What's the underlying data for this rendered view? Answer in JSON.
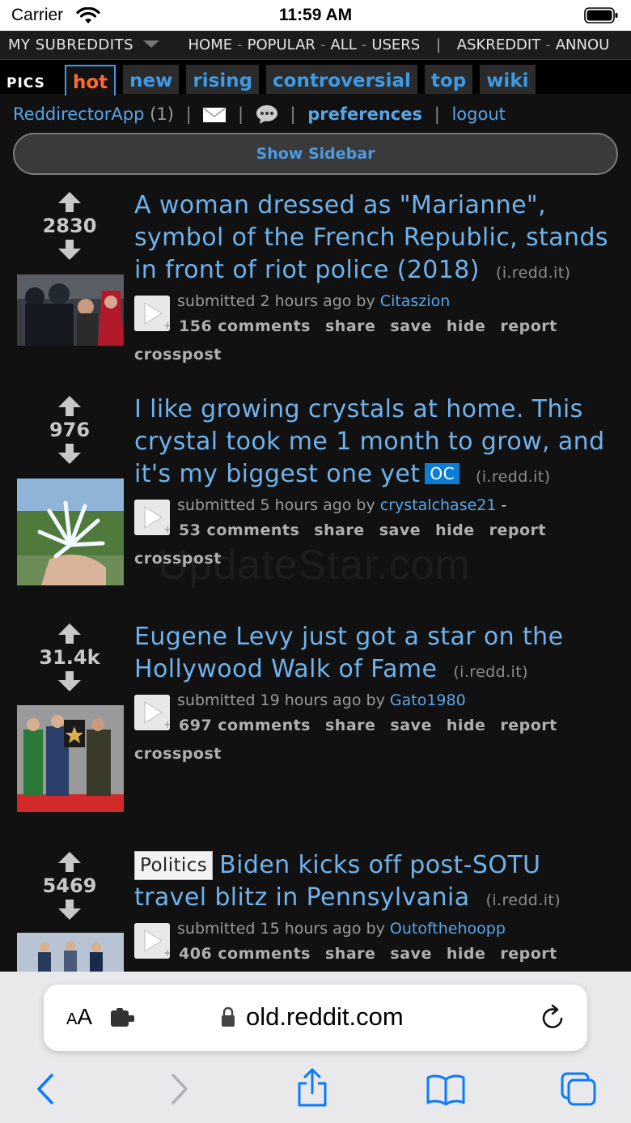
{
  "status": {
    "carrier": "Carrier",
    "time": "11:59 AM"
  },
  "sr_bar": {
    "my_subreddits": "MY SUBREDDITS",
    "links": [
      "HOME",
      "POPULAR",
      "ALL",
      "USERS"
    ],
    "subs": [
      "ASKREDDIT",
      "ANNOU"
    ]
  },
  "header": {
    "subreddit": "PICS",
    "tabs": [
      "hot",
      "new",
      "rising",
      "controversial",
      "top",
      "wiki"
    ],
    "active_tab": "hot"
  },
  "userline": {
    "username": "ReddirectorApp",
    "karma": "(1)",
    "preferences": "preferences",
    "logout": "logout"
  },
  "sidebar_button": "Show Sidebar",
  "posts": [
    {
      "score": "2830",
      "title": "A woman dressed as \"Marianne\", symbol of the French Republic, stands in front of riot police (2018)",
      "domain": "(i.redd.it)",
      "submitted": "submitted 2 hours ago by",
      "author": "Citaszion",
      "comments": "156 comments",
      "share": "share",
      "save": "save",
      "hide": "hide",
      "report": "report",
      "crosspost": "crosspost"
    },
    {
      "score": "976",
      "title": "I like growing crystals at home. This crystal took me 1 month to grow, and it's my biggest one yet",
      "oc": "OC",
      "domain": "(i.redd.it)",
      "submitted": "submitted 5 hours ago by",
      "author": "crystalchase21",
      "author_suffix": "-",
      "comments": "53 comments",
      "share": "share",
      "save": "save",
      "hide": "hide",
      "report": "report",
      "crosspost": "crosspost"
    },
    {
      "score": "31.4k",
      "title": "Eugene Levy just got a star on the Hollywood Walk of Fame",
      "domain": "(i.redd.it)",
      "submitted": "submitted 19 hours ago by",
      "author": "Gato1980",
      "comments": "697 comments",
      "share": "share",
      "save": "save",
      "hide": "hide",
      "report": "report",
      "crosspost": "crosspost"
    },
    {
      "score": "5469",
      "flair": "Politics",
      "title": "Biden kicks off post-SOTU travel blitz in Pennsylvania",
      "domain": "(i.redd.it)",
      "submitted": "submitted 15 hours ago by",
      "author": "Outofthehoopp",
      "comments": "406 comments",
      "share": "share",
      "save": "save",
      "hide": "hide",
      "report": "report"
    }
  ],
  "watermark": "UpdateStar.com",
  "safari": {
    "aa": "AA",
    "url": "old.reddit.com"
  },
  "icons": {
    "upvote": "up-arrow-icon",
    "downvote": "down-arrow-icon",
    "back": "back-chevron-icon",
    "forward": "forward-chevron-icon",
    "share": "share-icon",
    "bookmarks": "bookmarks-icon",
    "tabs": "tabs-icon"
  },
  "colors": {
    "link": "#6fb2ec",
    "active_tab": "#ff6a33",
    "oc": "#0a7dd6",
    "ios_blue": "#0a7aff"
  }
}
